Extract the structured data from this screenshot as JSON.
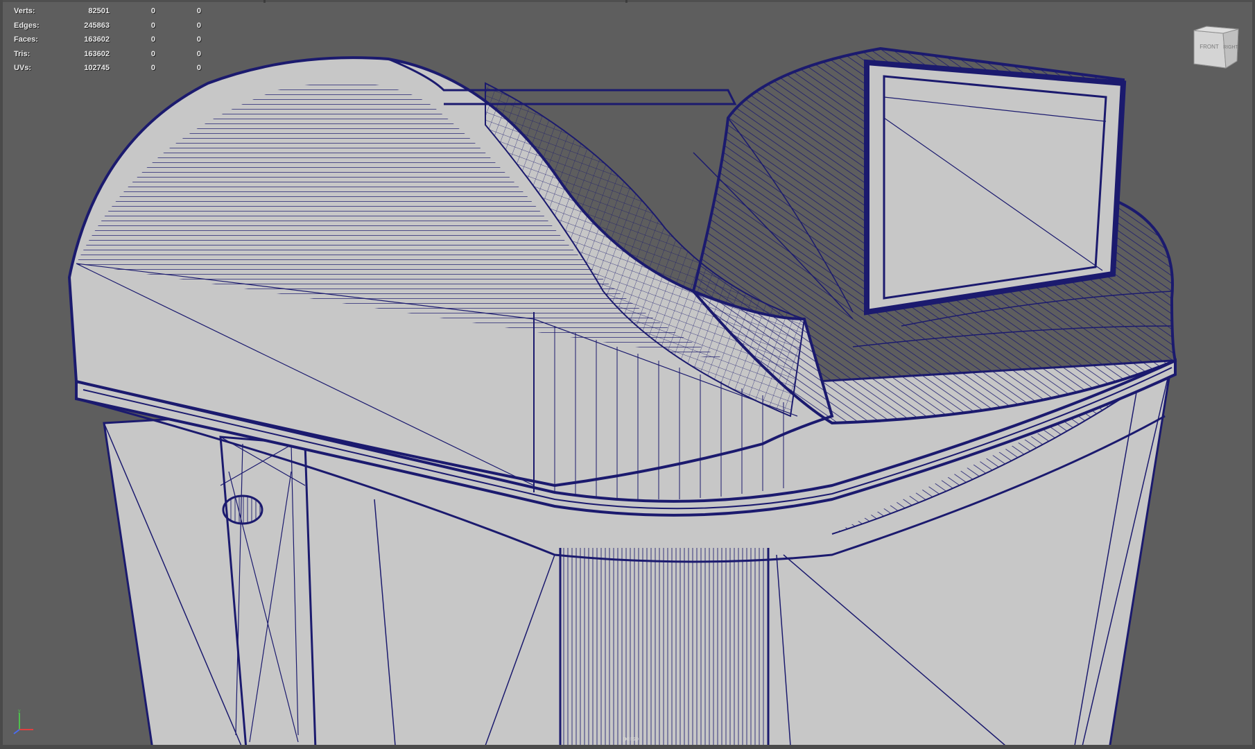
{
  "viewport": {
    "camera_name": "persp",
    "background_color": "#5e5e5e",
    "mesh_fill_color": "#c7c7c7",
    "wire_color": "#1b1a6e"
  },
  "hud": {
    "rows": [
      {
        "label": "Verts:",
        "value": "82501",
        "sel": "0",
        "sel2": "0"
      },
      {
        "label": "Edges:",
        "value": "245863",
        "sel": "0",
        "sel2": "0"
      },
      {
        "label": "Faces:",
        "value": "163602",
        "sel": "0",
        "sel2": "0"
      },
      {
        "label": "Tris:",
        "value": "163602",
        "sel": "0",
        "sel2": "0"
      },
      {
        "label": "UVs:",
        "value": "102745",
        "sel": "0",
        "sel2": "0"
      }
    ]
  },
  "viewcube": {
    "front_label": "FRONT",
    "right_label": "RIGHT"
  },
  "axis_gizmo": {
    "icon": "axis-gizmo-icon",
    "x_color": "#e04040",
    "y_color": "#4ec04e",
    "z_color": "#4a6cf0"
  }
}
